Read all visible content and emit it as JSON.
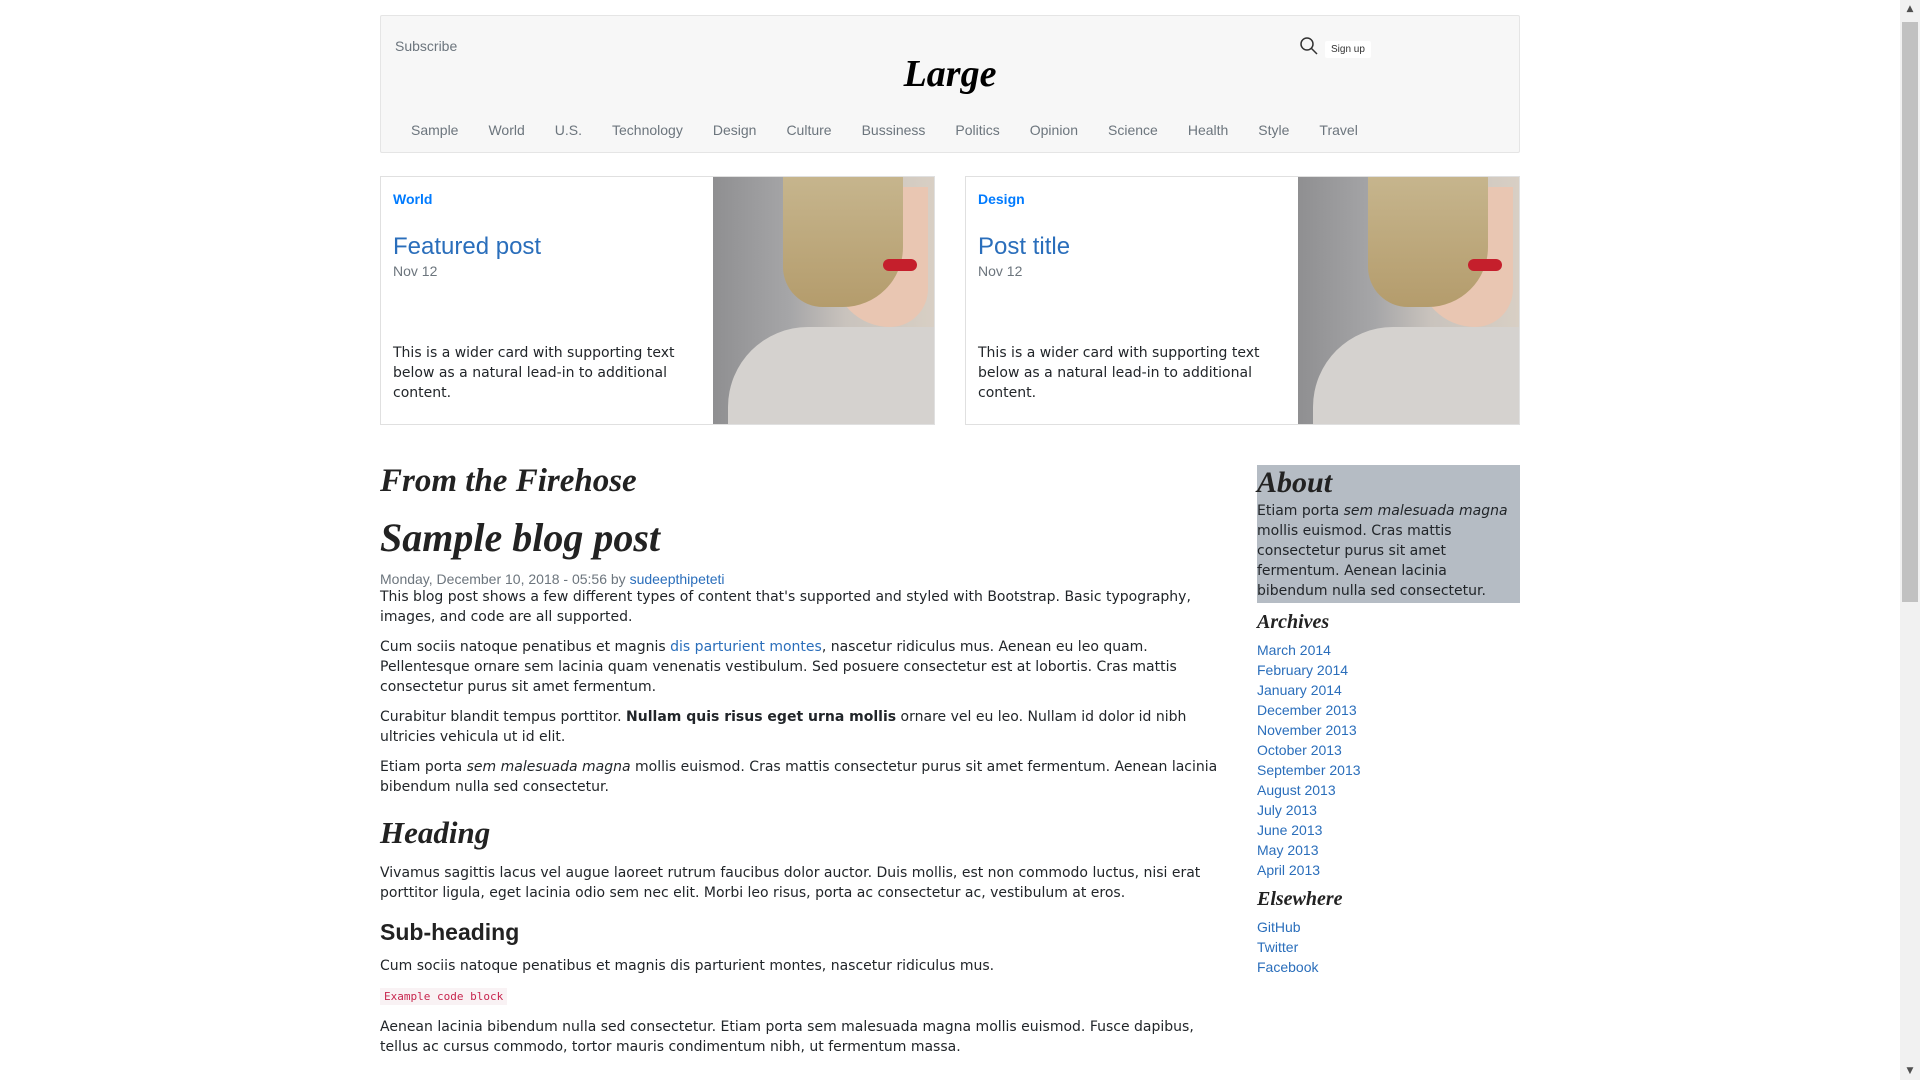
{
  "header": {
    "subscribe": "Subscribe",
    "brand": "Large",
    "signup": "Sign up",
    "nav": [
      "Sample",
      "World",
      "U.S.",
      "Technology",
      "Design",
      "Culture",
      "Bussiness",
      "Politics",
      "Opinion",
      "Science",
      "Health",
      "Style",
      "Travel"
    ]
  },
  "cards": [
    {
      "category": "World",
      "title": "Featured post",
      "date": "Nov 12",
      "text": "This is a wider card with supporting text below as a natural lead-in to additional content."
    },
    {
      "category": "Design",
      "title": "Post title",
      "date": "Nov 12",
      "text": "This is a wider card with supporting text below as a natural lead-in to additional content."
    }
  ],
  "main": {
    "section_title": "From the Firehose",
    "post_title": "Sample blog post",
    "meta_prefix": "Monday, December 10, 2018 - 05:56 by ",
    "author": "sudeepthipeteti",
    "p1": "This blog post shows a few different types of content that's supported and styled with Bootstrap. Basic typography, images, and code are all supported.",
    "p2a": "Cum sociis natoque penatibus et magnis ",
    "p2link": "dis parturient montes",
    "p2b": ", nascetur ridiculus mus. Aenean eu leo quam. Pellentesque ornare sem lacinia quam venenatis vestibulum. Sed posuere consectetur est at lobortis. Cras mattis consectetur purus sit amet fermentum.",
    "p3a": "Curabitur blandit tempus porttitor. ",
    "p3bold": "Nullam quis risus eget urna mollis",
    "p3b": " ornare vel eu leo. Nullam id dolor id nibh ultricies vehicula ut id elit.",
    "p4a": "Etiam porta ",
    "p4em": "sem malesuada magna",
    "p4b": " mollis euismod. Cras mattis consectetur purus sit amet fermentum. Aenean lacinia bibendum nulla sed consectetur.",
    "heading": "Heading",
    "p5": "Vivamus sagittis lacus vel augue laoreet rutrum faucibus dolor auctor. Duis mollis, est non commodo luctus, nisi erat porttitor ligula, eget lacinia odio sem nec elit. Morbi leo risus, porta ac consectetur ac, vestibulum at eros.",
    "subheading": "Sub-heading",
    "p6": "Cum sociis natoque penatibus et magnis dis parturient montes, nascetur ridiculus mus.",
    "code": "Example code block",
    "p7": "Aenean lacinia bibendum nulla sed consectetur. Etiam porta sem malesuada magna mollis euismod. Fusce dapibus, tellus ac cursus commodo, tortor mauris condimentum nibh, ut fermentum massa."
  },
  "sidebar": {
    "about_title": "About",
    "about_a": "Etiam porta ",
    "about_em": "sem malesuada magna",
    "about_b": " mollis euismod. Cras mattis consectetur purus sit amet fermentum. Aenean lacinia bibendum nulla sed consectetur.",
    "archives_title": "Archives",
    "archives": [
      "March 2014",
      "February 2014",
      "January 2014",
      "December 2013",
      "November 2013",
      "October 2013",
      "September 2013",
      "August 2013",
      "July 2013",
      "June 2013",
      "May 2013",
      "April 2013"
    ],
    "elsewhere_title": "Elsewhere",
    "elsewhere": [
      "GitHub",
      "Twitter",
      "Facebook"
    ]
  },
  "colors": {
    "link": "#2a6ebb",
    "category": "#007bff",
    "about_bg": "#b5bcc4"
  }
}
